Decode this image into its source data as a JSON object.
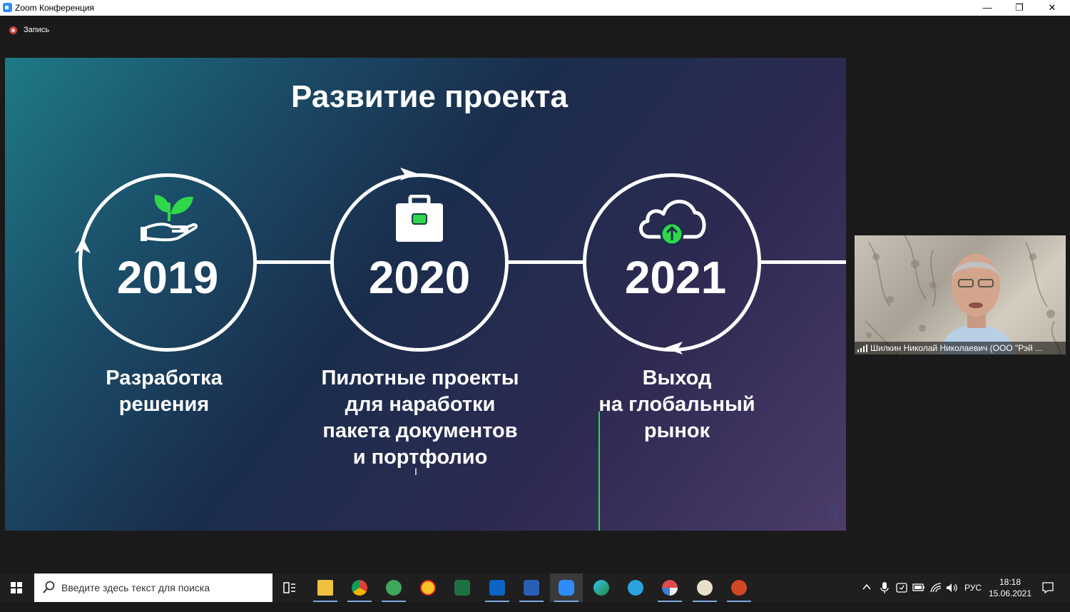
{
  "window": {
    "title": "Zoom Конференция",
    "minimize": "—",
    "restore": "❐",
    "close": "✕"
  },
  "recording": {
    "label": "Запись"
  },
  "slide": {
    "title": "Развитие проекта",
    "milestones": [
      {
        "year": "2019",
        "icon": "sprout-in-hand-icon",
        "caption_lines": [
          "Разработка",
          "решения"
        ]
      },
      {
        "year": "2020",
        "icon": "briefcase-icon",
        "caption_lines": [
          "Пилотные проекты",
          "для наработки",
          "пакета документов",
          "и портфолио"
        ]
      },
      {
        "year": "2021",
        "icon": "cloud-upload-icon",
        "caption_lines": [
          "Выход",
          "на глобальный",
          "рынок"
        ]
      }
    ],
    "page_number": "8",
    "colors": {
      "accent_green": "#2ed84a",
      "text": "#ffffff"
    }
  },
  "participant": {
    "name": "Шилкин Николай Николаевич (ООО \"Рэй ..."
  },
  "taskbar": {
    "search_placeholder": "Введите здесь текст для поиска",
    "apps": [
      "task-view",
      "file-explorer",
      "chrome",
      "browser-globe",
      "1c",
      "excel",
      "outlook",
      "word",
      "zoom",
      "edge",
      "telegram",
      "paint-3d",
      "paint",
      "powerpoint"
    ],
    "language": "РУС",
    "time": "18:18",
    "date": "15.06.2021"
  }
}
